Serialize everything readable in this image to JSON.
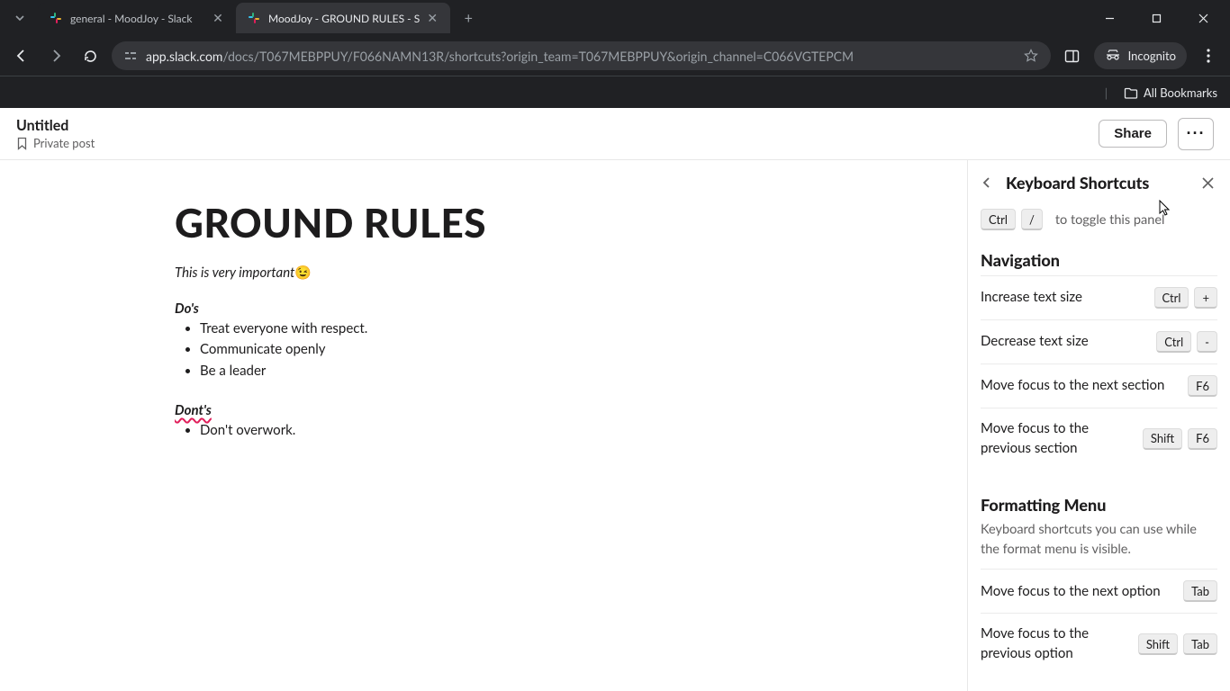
{
  "browser": {
    "tabs": [
      {
        "title": "general - MoodJoy - Slack",
        "active": false
      },
      {
        "title": "MoodJoy - GROUND RULES - S",
        "active": true
      }
    ],
    "url_host": "app.slack.com",
    "url_path": "/docs/T067MEBPPUY/F066NAMN13R/shortcuts?origin_team=T067MEBPPUY&origin_channel=C066VGTEPCM",
    "incognito_label": "Incognito",
    "all_bookmarks_label": "All Bookmarks"
  },
  "doc_header": {
    "title": "Untitled",
    "privacy": "Private post",
    "share_label": "Share"
  },
  "document": {
    "heading": "GROUND RULES",
    "intro_italic": "This is very important",
    "intro_emoji": "😉",
    "dos_heading": "Do's",
    "dos_items": [
      "Treat everyone with respect.",
      "Communicate openly",
      "Be a leader"
    ],
    "donts_heading": "Dont's",
    "donts_items": [
      "Don't overwork."
    ]
  },
  "panel": {
    "title": "Keyboard Shortcuts",
    "toggle_keys": [
      "Ctrl",
      "/"
    ],
    "toggle_text": "to toggle this panel",
    "sections": [
      {
        "title": "Navigation",
        "desc": "",
        "rows": [
          {
            "label": "Increase text size",
            "keys": [
              "Ctrl",
              "+"
            ]
          },
          {
            "label": "Decrease text size",
            "keys": [
              "Ctrl",
              "-"
            ]
          },
          {
            "label": "Move focus to the next section",
            "keys": [
              "F6"
            ]
          },
          {
            "label": "Move focus to the previous section",
            "keys": [
              "Shift",
              "F6"
            ]
          }
        ]
      },
      {
        "title": "Formatting Menu",
        "desc": "Keyboard shortcuts you can use while the format menu is visible.",
        "rows": [
          {
            "label": "Move focus to the next option",
            "keys": [
              "Tab"
            ]
          },
          {
            "label": "Move focus to the previous option",
            "keys": [
              "Shift",
              "Tab"
            ]
          }
        ]
      }
    ]
  }
}
